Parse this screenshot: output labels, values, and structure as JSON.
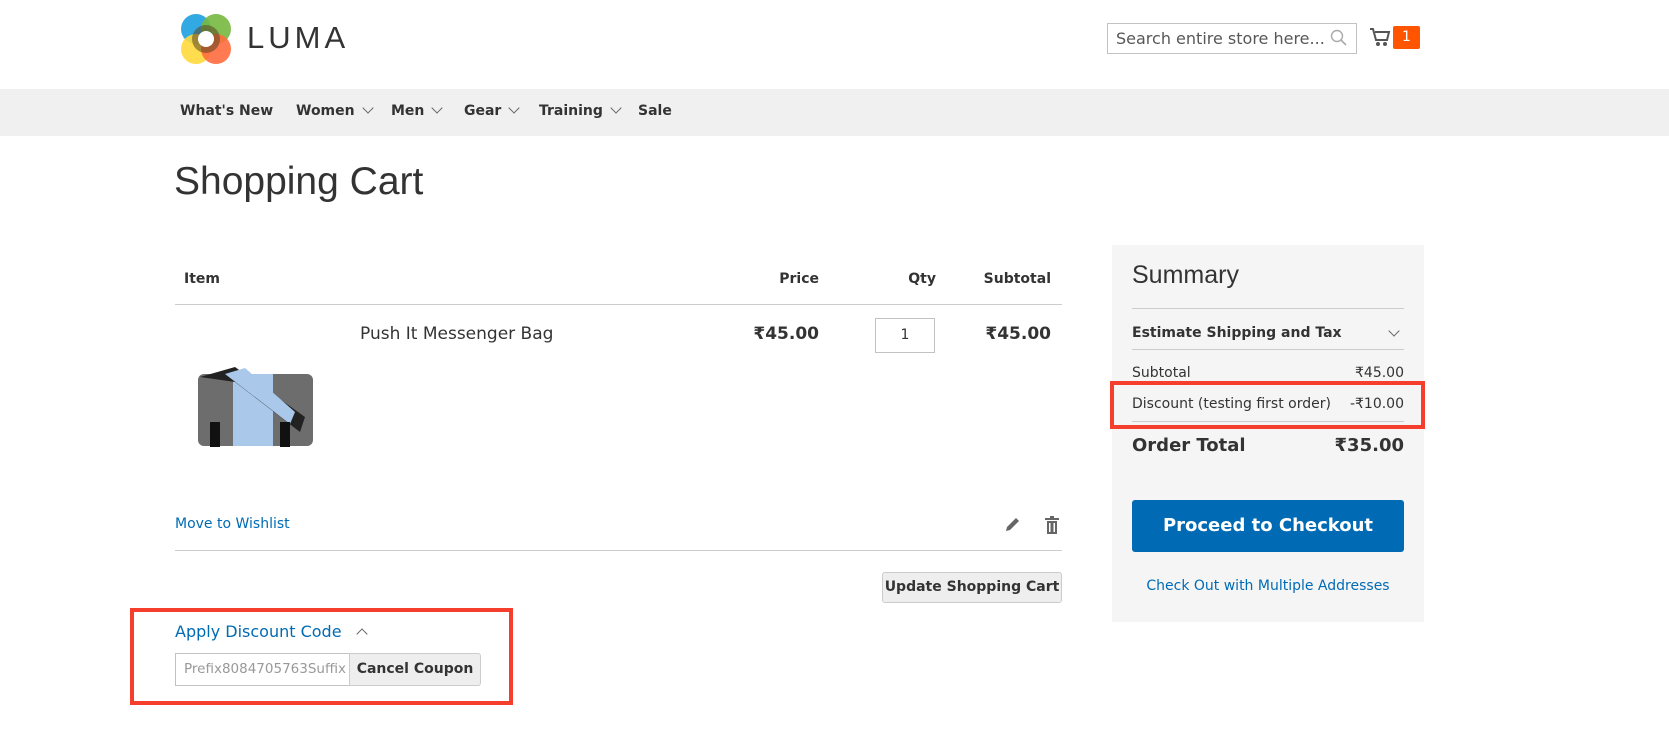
{
  "header": {
    "logo_text": "LUMA",
    "search_placeholder": "Search entire store here...",
    "cart_count": "1"
  },
  "nav": [
    {
      "label": "What's New",
      "dropdown": false
    },
    {
      "label": "Women",
      "dropdown": true
    },
    {
      "label": "Men",
      "dropdown": true
    },
    {
      "label": "Gear",
      "dropdown": true
    },
    {
      "label": "Training",
      "dropdown": true
    },
    {
      "label": "Sale",
      "dropdown": false
    }
  ],
  "page_title": "Shopping Cart",
  "cart": {
    "columns": [
      "Item",
      "Price",
      "Qty",
      "Subtotal"
    ],
    "item": {
      "name": "Push It Messenger Bag",
      "price": "₹45.00",
      "qty": "1",
      "subtotal": "₹45.00"
    },
    "move_to_wishlist": "Move to Wishlist",
    "update_button": "Update Shopping Cart"
  },
  "discount": {
    "title": "Apply Discount Code",
    "code_value": "Prefix8084705763Suffix",
    "cancel_button": "Cancel Coupon"
  },
  "summary": {
    "title": "Summary",
    "estimate": "Estimate Shipping and Tax",
    "subtotal_label": "Subtotal",
    "subtotal_value": "₹45.00",
    "discount_label": "Discount (testing first order)",
    "discount_value": "-₹10.00",
    "total_label": "Order Total",
    "total_value": "₹35.00",
    "checkout_button": "Proceed to Checkout",
    "multi_address": "Check Out with Multiple Addresses"
  },
  "colors": {
    "accent": "#006bb4",
    "badge": "#ff5501",
    "highlight": "#f63e2c"
  }
}
